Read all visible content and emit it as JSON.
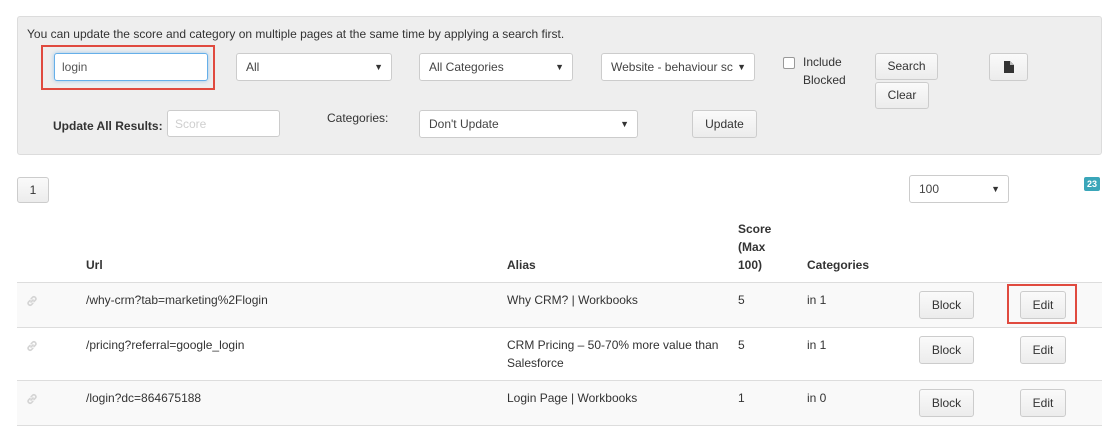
{
  "filter_panel": {
    "intro_text": "You can update the score and category on multiple pages at the same time by applying a search first.",
    "search_value": "login",
    "status_select": "All",
    "category_select": "All Categories",
    "scope_select": "Website - behaviour sc",
    "include_blocked_label_1": "Include",
    "include_blocked_label_2": "Blocked",
    "search_button": "Search",
    "clear_button": "Clear",
    "export_icon": "document-icon",
    "update_all_label": "Update All Results:",
    "score_placeholder": "Score",
    "categories_label": "Categories:",
    "categories_update_select": "Don't Update",
    "update_button": "Update"
  },
  "pagination": {
    "current_page": "1",
    "page_size": "100",
    "total_count": "23"
  },
  "table": {
    "headers": {
      "url": "Url",
      "alias": "Alias",
      "score_1": "Score",
      "score_2": "(Max",
      "score_3": "100)",
      "categories": "Categories"
    },
    "rows": [
      {
        "url": "/why-crm?tab=marketing%2Flogin",
        "alias_1": "Why CRM? | Workbooks",
        "alias_2": "",
        "score": "5",
        "categories": "in 1",
        "block": "Block",
        "edit": "Edit"
      },
      {
        "url": "/pricing?referral=google_login",
        "alias_1": "CRM Pricing – 50-70% more value than",
        "alias_2": "Salesforce",
        "score": "5",
        "categories": "in 1",
        "block": "Block",
        "edit": "Edit"
      },
      {
        "url": "/login?dc=864675188",
        "alias_1": "Login Page | Workbooks",
        "alias_2": "",
        "score": "1",
        "categories": "in 0",
        "block": "Block",
        "edit": "Edit"
      }
    ]
  },
  "colors": {
    "highlight": "#e04a3f",
    "badge": "#3aa6b9"
  }
}
